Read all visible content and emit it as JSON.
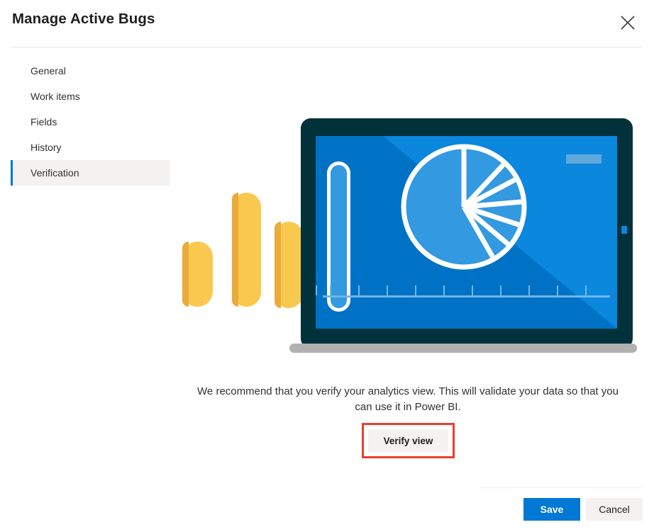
{
  "header": {
    "title": "Manage Active Bugs",
    "close_icon": "close-icon"
  },
  "sidebar": {
    "items": [
      {
        "label": "General",
        "selected": false
      },
      {
        "label": "Work items",
        "selected": false
      },
      {
        "label": "Fields",
        "selected": false
      },
      {
        "label": "History",
        "selected": false
      },
      {
        "label": "Verification",
        "selected": true
      }
    ]
  },
  "main": {
    "illustration": {
      "name": "analytics-tablet-illustration",
      "tablet_bezel_color": "#01313a",
      "screen_color": "#0072c6",
      "screen_highlight_color": "#0b87dd",
      "accent_yellow": "#f9c84f",
      "pie_fill_color": "#3399e0",
      "pie_outline_color": "#ffffff",
      "axis_tick_count": 11
    },
    "recommend_text": "We recommend that you verify your analytics view. This will validate your data so that you can use it in Power BI.",
    "verify_button_label": "Verify view",
    "annotation_color": "#e8402a"
  },
  "footer": {
    "save_label": "Save",
    "cancel_label": "Cancel",
    "save_color": "#0078d4"
  }
}
